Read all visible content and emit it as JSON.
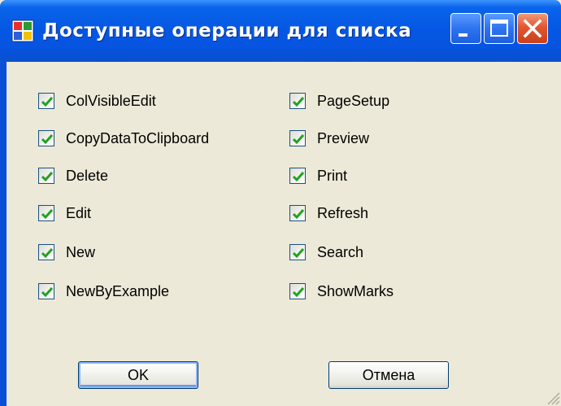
{
  "window": {
    "title": "Доступные операции для списка"
  },
  "checkboxes": {
    "left": [
      {
        "label": "ColVisibleEdit",
        "checked": true
      },
      {
        "label": "CopyDataToClipboard",
        "checked": true
      },
      {
        "label": "Delete",
        "checked": true
      },
      {
        "label": "Edit",
        "checked": true
      },
      {
        "label": "New",
        "checked": true
      },
      {
        "label": "NewByExample",
        "checked": true
      }
    ],
    "right": [
      {
        "label": "PageSetup",
        "checked": true
      },
      {
        "label": "Preview",
        "checked": true
      },
      {
        "label": "Print",
        "checked": true
      },
      {
        "label": "Refresh",
        "checked": true
      },
      {
        "label": "Search",
        "checked": true
      },
      {
        "label": "ShowMarks",
        "checked": true
      }
    ]
  },
  "buttons": {
    "ok_label": "OK",
    "cancel_label": "Отмена"
  },
  "colors": {
    "titlebar": "#0558e4",
    "face": "#ece9d8",
    "check": "#21a121",
    "close_button": "#e3562e"
  }
}
